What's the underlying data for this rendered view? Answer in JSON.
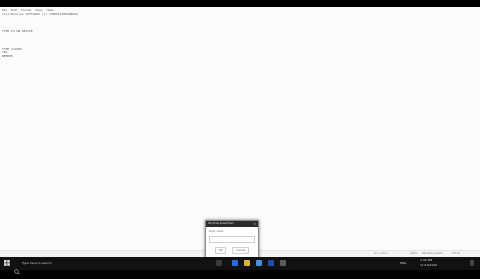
{
  "editor": {
    "menu": [
      "File",
      "Edit",
      "Format",
      "View",
      "Help"
    ],
    "title_line": "LocalMachine SOFTWARE (7).TOBEDEFINEDNEDED",
    "lines": [
      "",
      "",
      "",
      "TYPE IS ON DEVICE",
      "",
      "",
      "",
      "",
      "TYPE CLOSED",
      "YES",
      "REMOVE"
    ],
    "status": {
      "position": "Ln 1, Col 1",
      "zoom": "100%",
      "line_ending": "Windows (CRLF)",
      "encoding": "UTF-8"
    }
  },
  "dialog": {
    "title": "Windows PowerShell",
    "close": "✕",
    "prompt": "Enter value",
    "input_placeholder": "",
    "buttons": [
      "OK",
      "Cancel"
    ]
  },
  "taskbar": {
    "search_text": "Type here to search",
    "clock": "4:36 PM",
    "date": "11/16/2020",
    "lang": "ENG"
  }
}
